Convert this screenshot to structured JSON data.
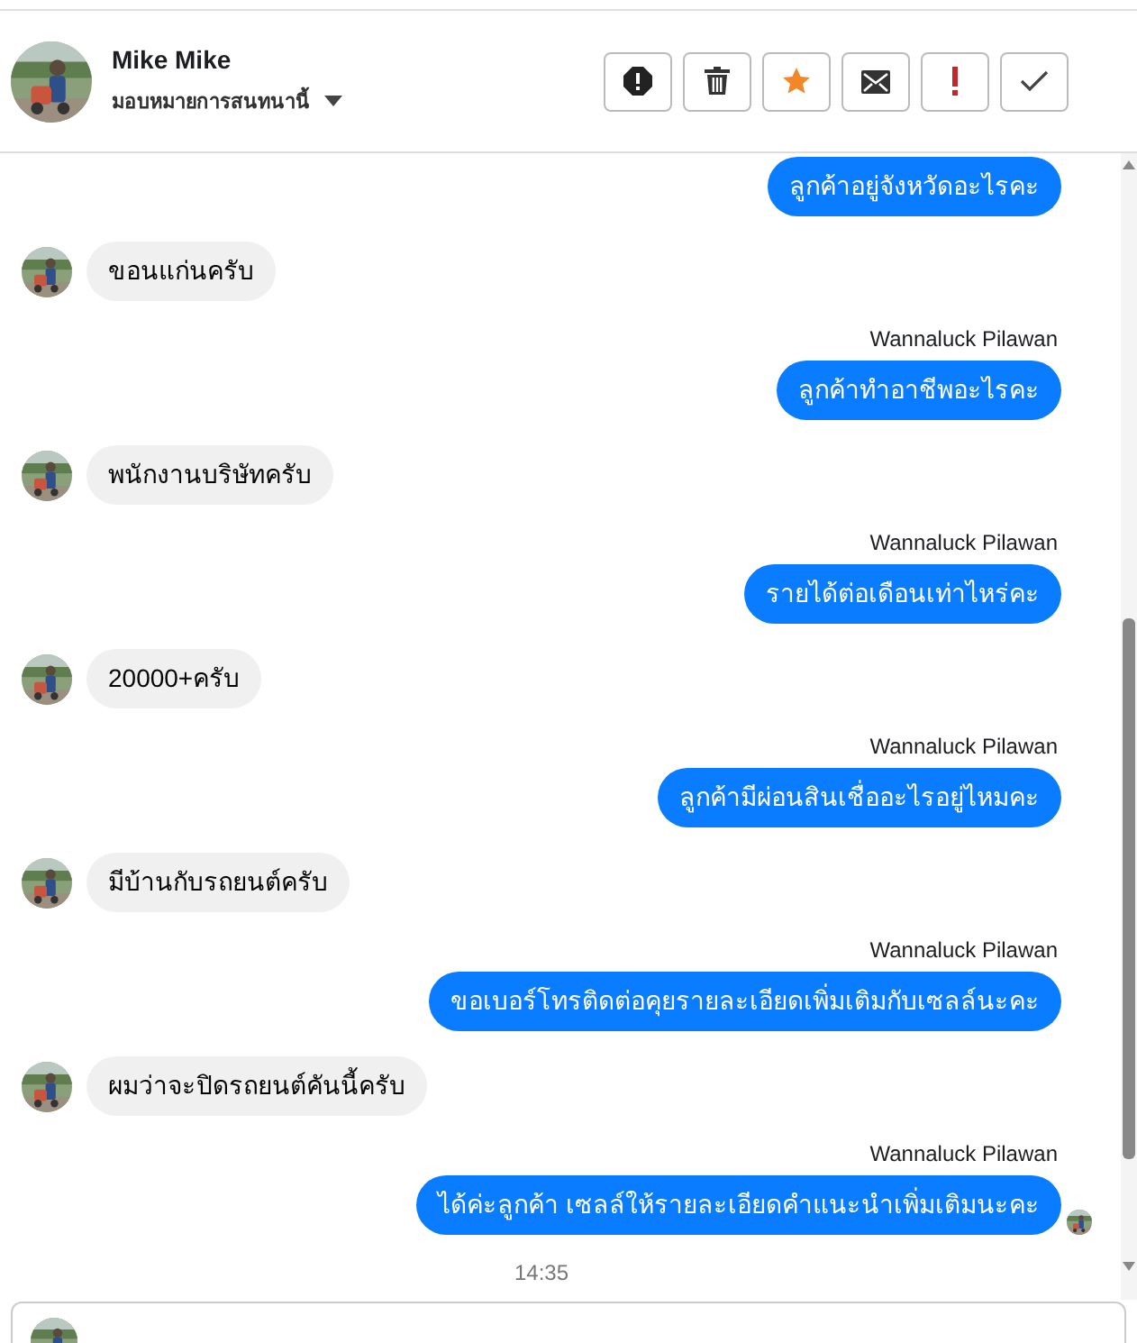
{
  "header": {
    "name": "Mike Mike",
    "subtitle": "มอบหมายการสนทนานี้"
  },
  "messages": [
    {
      "kind": "outgoing",
      "text": "ลูกค้าอยู่จังหวัดอะไรคะ",
      "seen": false
    },
    {
      "kind": "incoming",
      "text": "ขอนแก่นครับ"
    },
    {
      "kind": "outgoing",
      "sender": "Wannaluck Pilawan",
      "text": "ลูกค้าทำอาชีพอะไรคะ",
      "seen": false
    },
    {
      "kind": "incoming",
      "text": "พนักงานบริษัทครับ"
    },
    {
      "kind": "outgoing",
      "sender": "Wannaluck Pilawan",
      "text": "รายได้ต่อเดือนเท่าไหร่คะ",
      "seen": false
    },
    {
      "kind": "incoming",
      "text": "20000+ครับ"
    },
    {
      "kind": "outgoing",
      "sender": "Wannaluck Pilawan",
      "text": "ลูกค้ามีผ่อนสินเชื่ออะไรอยู่ไหมคะ",
      "seen": false
    },
    {
      "kind": "incoming",
      "text": "มีบ้านกับรถยนต์ครับ"
    },
    {
      "kind": "outgoing",
      "sender": "Wannaluck Pilawan",
      "text": "ขอเบอร์โทรติดต่อคุยรายละเอียดเพิ่มเติมกับเซลล์นะคะ",
      "seen": false
    },
    {
      "kind": "incoming",
      "text": "ผมว่าจะปิดรถยนต์คันนี้ครับ"
    },
    {
      "kind": "outgoing",
      "sender": "Wannaluck Pilawan",
      "text": "ได้ค่ะลูกค้า เซลล์ให้รายละเอียดคำแนะนำเพิ่มเติมนะคะ",
      "seen": true
    }
  ],
  "timestamp": "14:35"
}
